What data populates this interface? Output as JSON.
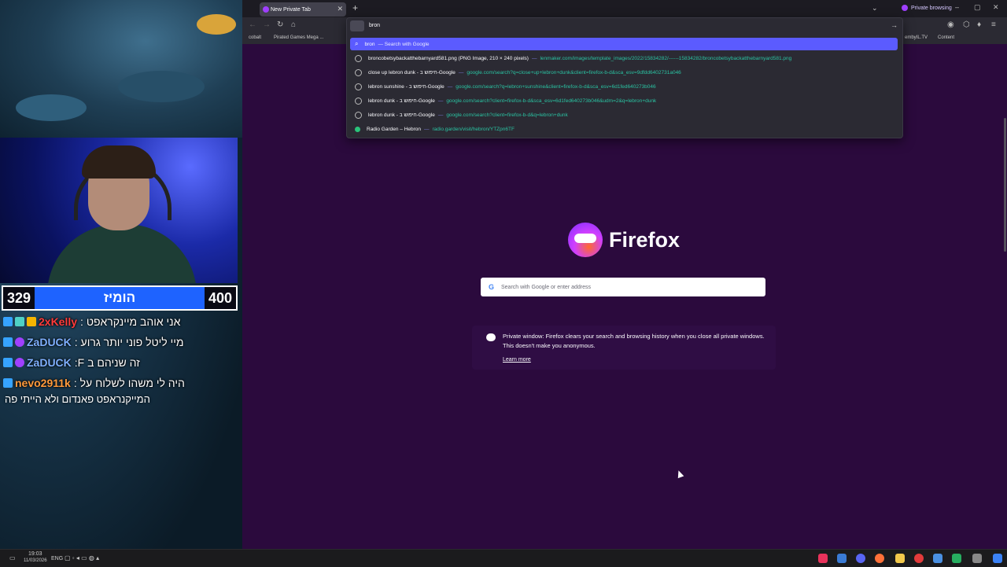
{
  "stream": {
    "score_left": "329",
    "score_label": "הומיז",
    "score_right": "400",
    "chat": [
      {
        "user": "2xKelly",
        "user_color": "#ff3b3b",
        "message": "אני אוהב מיינקראפט :"
      },
      {
        "user": "ZaDUCK",
        "user_color": "#7fb0ff",
        "message": "מיי ליטל פוני יותר גרוע :"
      },
      {
        "user": "ZaDUCK",
        "user_color": "#7fb0ff",
        "message": "זה שניהם ב F:"
      },
      {
        "user": "nevo2911k",
        "user_color": "#ff9a3c",
        "message": "היה לי משהו לשלוח על :"
      }
    ],
    "chat_continuation": "המייקנראפט פאנדום ולא הייתי פה"
  },
  "browser": {
    "tab_title": "New Private Tab",
    "new_tab_symbol": "+",
    "private_browsing_label": "Private browsing",
    "url_input": "bron",
    "bookmarks": [
      "cobalt",
      "Pirated Games Mega ...",
      "embyIL.TV",
      "Content"
    ],
    "suggestions": [
      {
        "title": "bron",
        "sub": "— Search with Google",
        "url": ""
      },
      {
        "title": "broncobetsybackatthebarnyard581.png (PNG Image, 210 × 240 pixels)",
        "sub": "—",
        "url": "lenmaker.com/images/template_images/2022/15834282/------15834282/broncobetsybackatthebarnyard581.png"
      },
      {
        "title": "close up lebron dunk - חיפוש ב-Google",
        "sub": "—",
        "url": "google.com/search?q=close+up+lebron+dunk&client=firefox-b-d&sca_esv=9dfdd6402731a046"
      },
      {
        "title": "lebron sunshine - חיפוש ב-Google",
        "sub": "—",
        "url": "google.com/search?q=lebron+sunshine&client=firefox-b-d&sca_esv=6d1fed640273b046"
      },
      {
        "title": "lebron dunk - חיפוש ב-Google",
        "sub": "—",
        "url": "google.com/search?client=firefox-b-d&sca_esv=6d1fed640273b046&udm=2&q=lebron+dunk"
      },
      {
        "title": "lebron dunk - חיפוש ב-Google",
        "sub": "—",
        "url": "google.com/search?client=firefox-b-d&q=lebron+dunk"
      },
      {
        "title": "Radio Garden – Hebron",
        "sub": "—",
        "url": "radio.garden/visit/hebron/YTZpn6TF"
      }
    ],
    "logo_text": "Firefox",
    "search_placeholder": "Search with Google or enter address",
    "private_message": "Private window: Firefox clears your search and browsing history when you close all private windows. This doesn't make you anonymous.",
    "learn_more": "Learn more"
  },
  "taskbar": {
    "time": "19:03",
    "date": "11/03/2026",
    "lang": "ENG"
  },
  "colors": {
    "private_bg": "#2b0a3d",
    "highlight": "#5b5bff",
    "score_blue": "#1e63ff"
  }
}
